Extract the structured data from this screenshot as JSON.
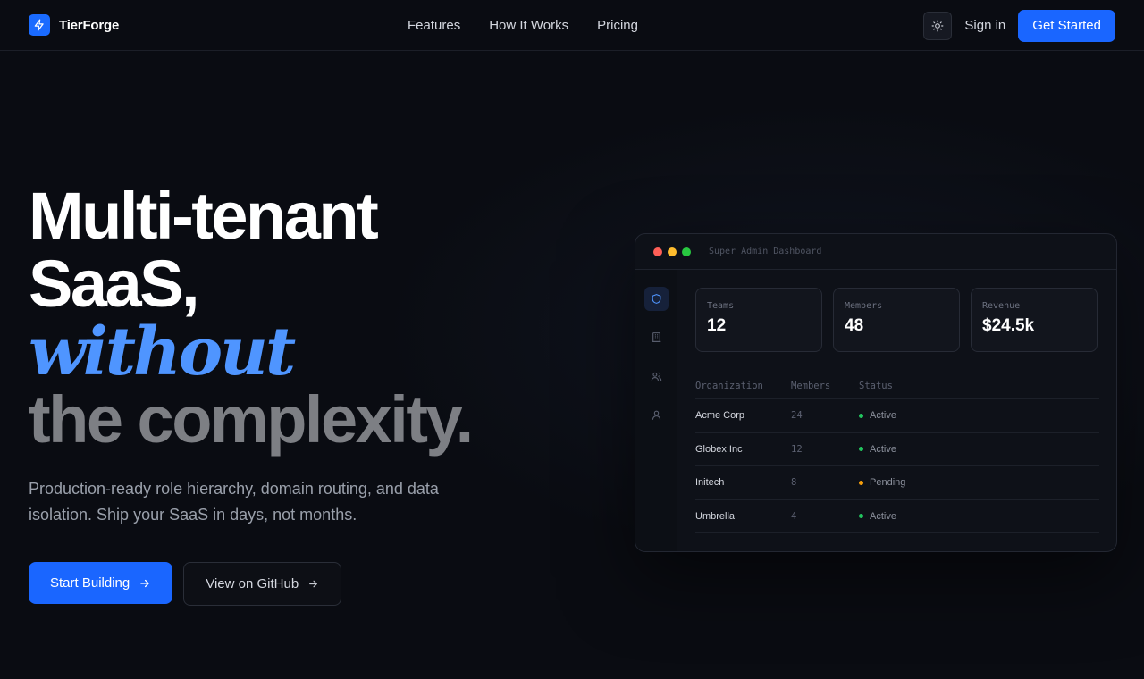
{
  "nav": {
    "brand": "TierForge",
    "links": [
      "Features",
      "How It Works",
      "Pricing"
    ],
    "sign_in": "Sign in",
    "get_started": "Get Started"
  },
  "hero": {
    "line1": "Multi-tenant",
    "line2": "SaaS,",
    "line3": "without",
    "line4": "the complexity.",
    "subtitle": "Production-ready role hierarchy, domain routing, and data isolation. Ship your SaaS in days, not months.",
    "primary_cta": "Start Building",
    "secondary_cta": "View on GitHub"
  },
  "dashboard": {
    "title": "Super Admin Dashboard",
    "stats": [
      {
        "label": "Teams",
        "value": "12"
      },
      {
        "label": "Members",
        "value": "48"
      },
      {
        "label": "Revenue",
        "value": "$24.5k"
      }
    ],
    "columns": [
      "Organization",
      "Members",
      "Status"
    ],
    "rows": [
      {
        "org": "Acme Corp",
        "members": "24",
        "status": "Active"
      },
      {
        "org": "Globex Inc",
        "members": "12",
        "status": "Active"
      },
      {
        "org": "Initech",
        "members": "8",
        "status": "Pending"
      },
      {
        "org": "Umbrella",
        "members": "4",
        "status": "Active"
      }
    ]
  },
  "colors": {
    "accent": "#1a66ff",
    "accent_text": "#4f95ff",
    "status_active": "#22c55e",
    "status_pending": "#f59e0b",
    "window_red": "#ff5f57",
    "window_yellow": "#febc2e",
    "window_green": "#28c840"
  },
  "icons": {
    "brand": "lightning-bolt-icon",
    "theme": "sun-icon",
    "arrow": "arrow-right-icon",
    "sidebar": [
      "shield-icon",
      "building-icon",
      "users-icon",
      "user-icon"
    ]
  }
}
